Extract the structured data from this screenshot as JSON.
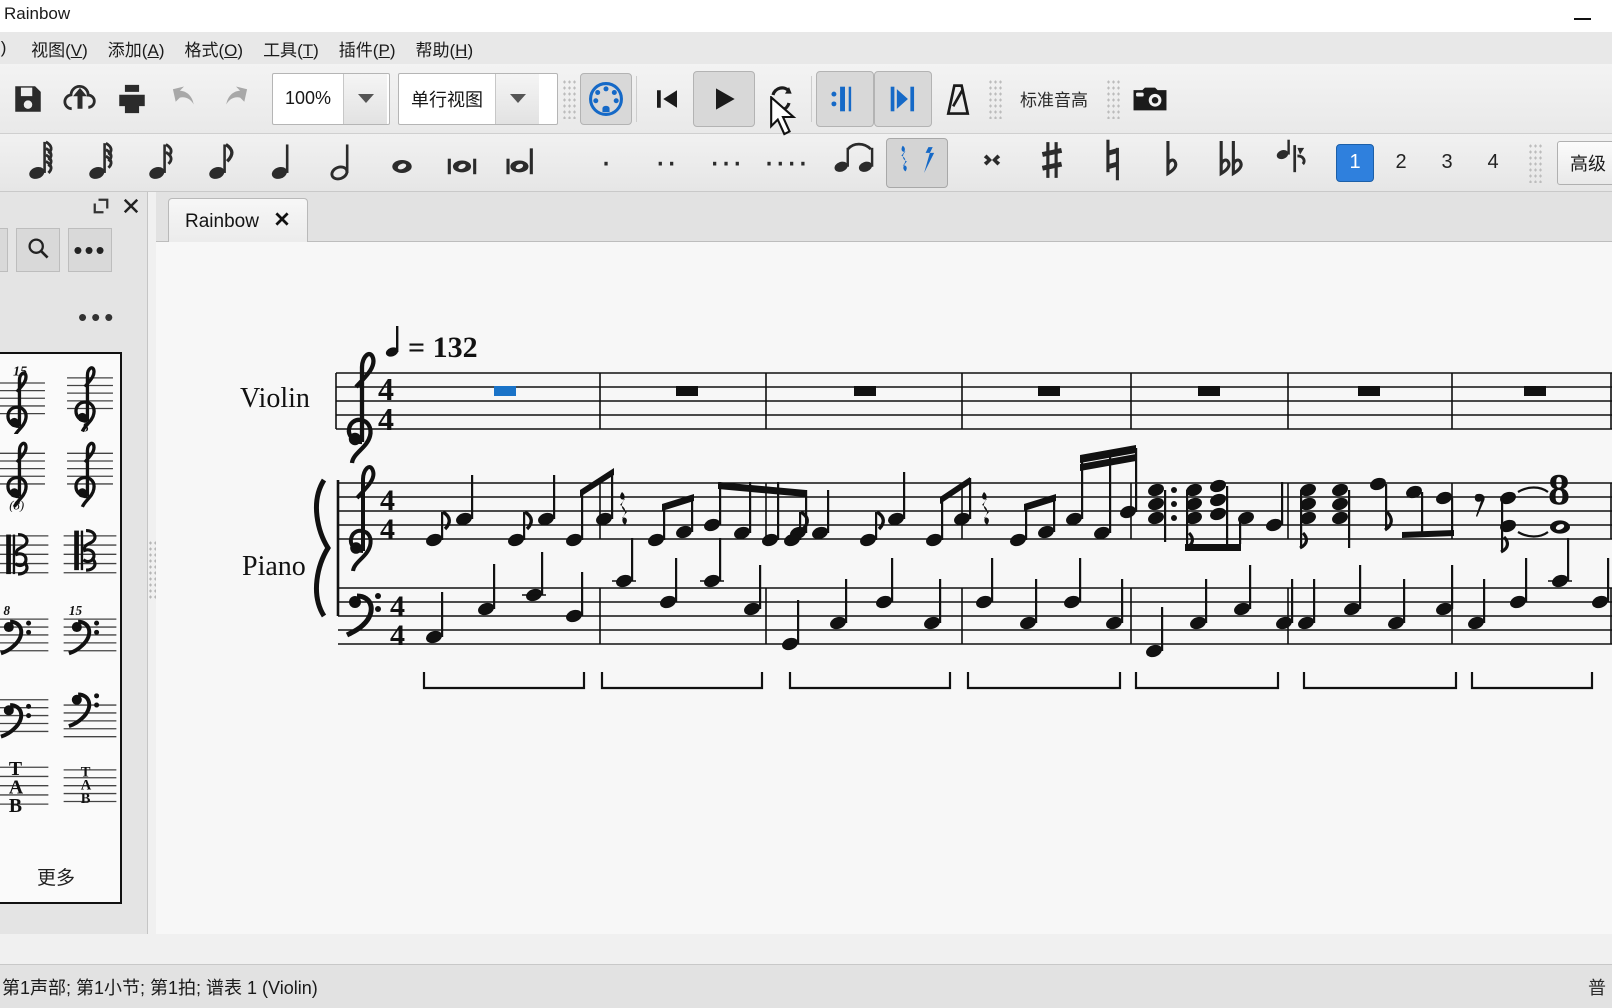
{
  "window": {
    "title": "Rainbow",
    "minimize_icon": "minimize-icon"
  },
  "menubar": {
    "items": [
      {
        "label": "",
        "key": "",
        "clipped": true
      },
      {
        "label": "视图",
        "key": "V"
      },
      {
        "label": "添加",
        "key": "A"
      },
      {
        "label": "格式",
        "key": "O"
      },
      {
        "label": "工具",
        "key": "T"
      },
      {
        "label": "插件",
        "key": "P"
      },
      {
        "label": "帮助",
        "key": "H"
      }
    ]
  },
  "toolbar_main": {
    "buttons": [
      {
        "name": "save-button",
        "icon": "save-icon"
      },
      {
        "name": "save-online-button",
        "icon": "cloud-upload-icon"
      },
      {
        "name": "print-button",
        "icon": "printer-icon"
      },
      {
        "name": "undo-button",
        "icon": "undo-icon"
      },
      {
        "name": "redo-button",
        "icon": "redo-icon"
      }
    ],
    "zoom": {
      "value": "100%",
      "arrow_icon": "chevron-down-icon"
    },
    "view_mode": {
      "value": "单行视图",
      "arrow_icon": "chevron-down-icon"
    },
    "note_input": {
      "name": "note-input-toggle",
      "icon": "note-input-icon",
      "active": true
    },
    "playback": [
      {
        "name": "rewind-button",
        "icon": "rewind-icon",
        "active": false
      },
      {
        "name": "play-button",
        "icon": "play-icon",
        "active": true
      },
      {
        "name": "loop-button",
        "icon": "loop-icon",
        "active": false
      }
    ],
    "play_repeats": {
      "name": "play-repeats-button",
      "icon": "repeat-bar-icon",
      "active": true
    },
    "play_chord_symbols": {
      "name": "play-chord-symbols-button",
      "icon": "playback-jump-icon",
      "active": true
    },
    "metronome": {
      "name": "metronome-button",
      "icon": "metronome-icon",
      "active": false
    },
    "tuning_label": "标准音高",
    "camera": {
      "name": "image-capture-button",
      "icon": "camera-icon"
    }
  },
  "toolbar_notes": {
    "durations": [
      {
        "name": "duration-64th",
        "icon": "note-64th-icon"
      },
      {
        "name": "duration-32nd",
        "icon": "note-32nd-icon"
      },
      {
        "name": "duration-16th",
        "icon": "note-16th-icon"
      },
      {
        "name": "duration-8th",
        "icon": "note-8th-icon"
      },
      {
        "name": "duration-quarter",
        "icon": "note-quarter-icon"
      },
      {
        "name": "duration-half",
        "icon": "note-half-icon"
      },
      {
        "name": "duration-whole",
        "icon": "note-whole-icon"
      },
      {
        "name": "duration-breve",
        "icon": "note-breve-icon"
      },
      {
        "name": "duration-longa",
        "icon": "note-longa-icon"
      }
    ],
    "dots": [
      {
        "name": "dot-1",
        "icon": "dot-single-icon",
        "glyph": "·"
      },
      {
        "name": "dot-2",
        "icon": "dot-double-icon",
        "glyph": "··"
      },
      {
        "name": "dot-3",
        "icon": "dot-triple-icon",
        "glyph": "···"
      },
      {
        "name": "dot-4",
        "icon": "dot-quadruple-icon",
        "glyph": "····"
      }
    ],
    "tie": {
      "name": "tie-button",
      "icon": "tie-icon"
    },
    "rest": {
      "name": "rest-button",
      "icon": "rest-icon",
      "active": true
    },
    "accidentals": [
      {
        "name": "double-sharp-button",
        "icon": "double-sharp-icon"
      },
      {
        "name": "sharp-button",
        "icon": "sharp-icon"
      },
      {
        "name": "natural-button",
        "icon": "natural-icon"
      },
      {
        "name": "flat-button",
        "icon": "flat-icon"
      },
      {
        "name": "double-flat-button",
        "icon": "double-flat-icon"
      }
    ],
    "flip": {
      "name": "flip-direction-button",
      "icon": "flip-direction-icon"
    },
    "voices": [
      {
        "label": "1",
        "selected": true
      },
      {
        "label": "2",
        "selected": false
      },
      {
        "label": "3",
        "selected": false
      },
      {
        "label": "4",
        "selected": false
      }
    ],
    "advanced": {
      "label": "高级 ("
    }
  },
  "palette": {
    "float_icon": "undock-icon",
    "close_icon": "close-icon",
    "search_icon": "search-icon",
    "more_icon": "more-options-icon",
    "overflow_icon": "palette-overflow-icon",
    "title": "",
    "cells": [
      {
        "name": "clef-treble-15ma",
        "label": "15"
      },
      {
        "name": "clef-treble-8va-plain",
        "label": ""
      },
      {
        "name": "clef-treble-8vb",
        "label": "8"
      },
      {
        "name": "clef-treble-8vb-paren",
        "label": "(8)"
      },
      {
        "name": "clef-alto",
        "label": ""
      },
      {
        "name": "clef-tenor",
        "label": ""
      },
      {
        "name": "clef-bass-8vb",
        "label": "8"
      },
      {
        "name": "clef-bass-15mb",
        "label": "15"
      },
      {
        "name": "clef-bass",
        "label": ""
      },
      {
        "name": "clef-bass-alt",
        "label": ""
      },
      {
        "name": "clef-tab-large",
        "label": "TAB"
      },
      {
        "name": "clef-tab-small",
        "label": "TAB"
      }
    ],
    "more_label": "更多"
  },
  "tabs": {
    "items": [
      {
        "label": "Rainbow",
        "close_icon": "close-icon",
        "active": true
      }
    ]
  },
  "score": {
    "tempo": {
      "note_icon": "quarter-note-icon",
      "text": "= 132"
    },
    "parts": [
      {
        "name": "Violin",
        "label": "Violin",
        "clef": "treble",
        "time": "4/4"
      },
      {
        "name": "Piano",
        "label": "Piano",
        "clef": "grand",
        "time": "4/4"
      }
    ],
    "selection": {
      "type": "whole-rest",
      "measure": 1,
      "staff": "Violin",
      "color": "#1a73c8"
    },
    "measure_count": 7
  },
  "statusbar": {
    "text": "第1声部; 第1小节; 第1拍; 谱表 1 (Violin)",
    "right_text": "普"
  },
  "colors": {
    "accent": "#2f80dd",
    "selection": "#1a73c8",
    "toolbar_bg": "#ececec",
    "canvas_bg": "#f7f7f7"
  }
}
